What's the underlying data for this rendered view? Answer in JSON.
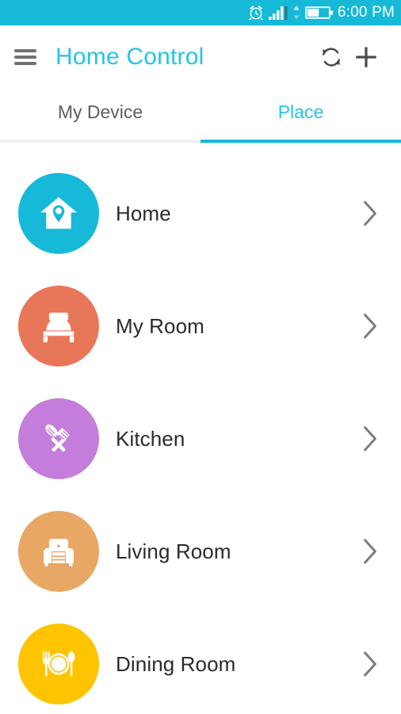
{
  "status_bar": {
    "background": "#16b9d8",
    "time": "6:00 PM",
    "icons": [
      "alarm-icon",
      "signal-icon",
      "data-transfer-icon",
      "battery-icon"
    ]
  },
  "app_bar": {
    "menu_icon": "hamburger-menu-icon",
    "title": "Home Control",
    "title_color": "#26c3e8",
    "refresh_icon": "refresh-icon",
    "add_icon": "plus-icon"
  },
  "tabs": {
    "active_index": 1,
    "accent_color": "#16b9d8",
    "items": [
      {
        "label": "My Device",
        "active": false
      },
      {
        "label": "Place",
        "active": true
      }
    ]
  },
  "place_list": {
    "items": [
      {
        "label": "Home",
        "icon": "house-pin-icon",
        "color": "#16b9d8",
        "chevron": "chevron-right-icon"
      },
      {
        "label": "My Room",
        "icon": "bed-icon",
        "color": "#e8775a",
        "chevron": "chevron-right-icon"
      },
      {
        "label": "Kitchen",
        "icon": "utensils-icon",
        "color": "#c47ddb",
        "chevron": "chevron-right-icon"
      },
      {
        "label": "Living Room",
        "icon": "armchair-icon",
        "color": "#e8a765",
        "chevron": "chevron-right-icon"
      },
      {
        "label": "Dining Room",
        "icon": "plate-cutlery-icon",
        "color": "#ffc400",
        "chevron": "chevron-right-icon"
      }
    ]
  }
}
